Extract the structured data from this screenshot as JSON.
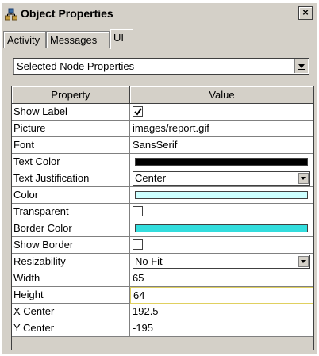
{
  "window": {
    "title": "Object Properties",
    "close_glyph": "×",
    "icon": "object-tree-icon"
  },
  "tabs": [
    {
      "label": "Activity",
      "active": false
    },
    {
      "label": "Messages",
      "active": false
    },
    {
      "label": "UI",
      "active": true
    }
  ],
  "selector": {
    "value": "Selected Node Properties"
  },
  "table": {
    "headers": [
      "Property",
      "Value"
    ],
    "rows": [
      {
        "name": "Show Label",
        "type": "checkbox",
        "checked": true
      },
      {
        "name": "Picture",
        "type": "text",
        "value": "images/report.gif"
      },
      {
        "name": "Font",
        "type": "text",
        "value": "SansSerif"
      },
      {
        "name": "Text Color",
        "type": "color",
        "color": "#000000"
      },
      {
        "name": "Text Justification",
        "type": "select",
        "value": "Center"
      },
      {
        "name": "Color",
        "type": "color",
        "color": "#ccffff"
      },
      {
        "name": "Transparent",
        "type": "checkbox",
        "checked": false
      },
      {
        "name": "Border Color",
        "type": "color",
        "color": "#33dddd"
      },
      {
        "name": "Show Border",
        "type": "checkbox",
        "checked": false
      },
      {
        "name": "Resizability",
        "type": "select",
        "value": "No Fit"
      },
      {
        "name": "Width",
        "type": "text",
        "value": "65"
      },
      {
        "name": "Height",
        "type": "text",
        "value": "64",
        "focused": true
      },
      {
        "name": "X Center",
        "type": "text",
        "value": "192.5"
      },
      {
        "name": "Y Center",
        "type": "text",
        "value": "-195"
      }
    ]
  }
}
